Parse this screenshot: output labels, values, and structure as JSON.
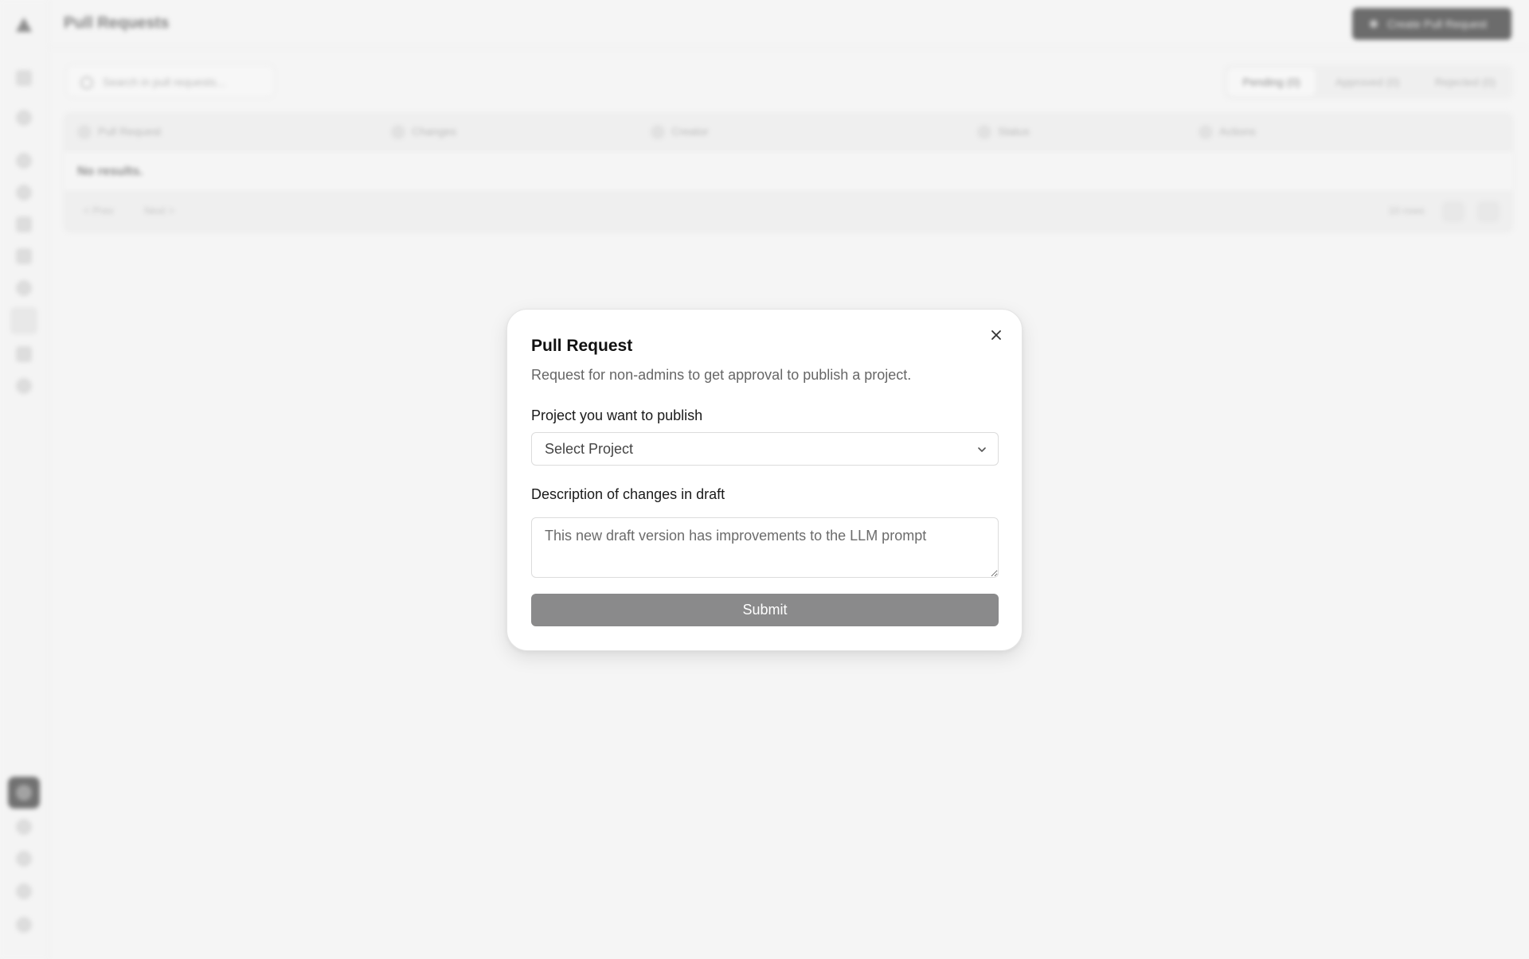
{
  "background": {
    "page_title": "Pull Requests",
    "top_button_label": "Create Pull Request",
    "search_placeholder": "Search in pull requests...",
    "filter_tabs": [
      {
        "label": "Pending (0)"
      },
      {
        "label": "Approved (0)"
      },
      {
        "label": "Rejected (0)"
      }
    ],
    "table": {
      "columns": [
        {
          "label": "Pull Request"
        },
        {
          "label": "Changes"
        },
        {
          "label": "Creator"
        },
        {
          "label": "Status"
        },
        {
          "label": "Actions"
        }
      ],
      "empty_text": "No results.",
      "pager_prev": "< Prev",
      "pager_next": "Next >",
      "rows_label": "10 rows"
    },
    "sidebar_icons": [
      "home-icon",
      "search-icon",
      "box-icon",
      "layers-icon",
      "pencil-icon",
      "grid-icon",
      "globe-icon",
      "git-pull-request-icon",
      "rocket-icon",
      "settings-icon",
      "brand-logo-icon",
      "user-icon",
      "help-icon",
      "lightbulb-icon",
      "account-icon"
    ]
  },
  "modal": {
    "title": "Pull Request",
    "description": "Request for non-admins to get approval to publish a project.",
    "project_label": "Project you want to publish",
    "project_select": {
      "selected": "Select Project"
    },
    "description_label": "Description of changes in draft",
    "description_placeholder": "This new draft version has improvements to the LLM prompt",
    "submit_label": "Submit",
    "close_icon": "close-icon"
  },
  "colors": {
    "background": "#f4f4f4",
    "modal_bg": "#ffffff",
    "submit_bg": "#8a8a8b",
    "text_primary": "#111111",
    "text_secondary": "#666666"
  }
}
